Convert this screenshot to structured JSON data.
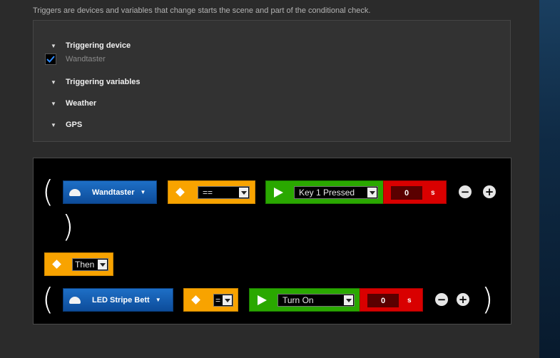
{
  "intro_text": "Triggers are devices and variables that change starts the scene and part of the conditional check.",
  "triggers": {
    "sections": [
      {
        "label": "Triggering device"
      },
      {
        "label": "Triggering variables"
      },
      {
        "label": "Weather"
      },
      {
        "label": "GPS"
      }
    ],
    "device": {
      "label": "Wandtaster",
      "checked": true
    }
  },
  "rule": {
    "open_paren": "(",
    "close_paren": ")",
    "condition": {
      "device": "Wandtaster",
      "operator": "==",
      "value": "Key 1 Pressed",
      "delay": "0",
      "delay_unit": "s"
    },
    "then_label": "Then",
    "action": {
      "device": "LED Stripe Bett",
      "operator": "=",
      "value": "Turn On",
      "delay": "0",
      "delay_unit": "s"
    },
    "remove_symbol": "−",
    "add_symbol": "+"
  },
  "colors": {
    "device": "#1e6fc6",
    "operator": "#f8a300",
    "action": "#2aa800",
    "delay": "#d90000"
  },
  "icons": {
    "caret": "chevron-down-icon",
    "check": "checkmark-icon",
    "bulb": "device-bulb-icon",
    "diamond": "diamond-icon",
    "play": "play-icon"
  }
}
